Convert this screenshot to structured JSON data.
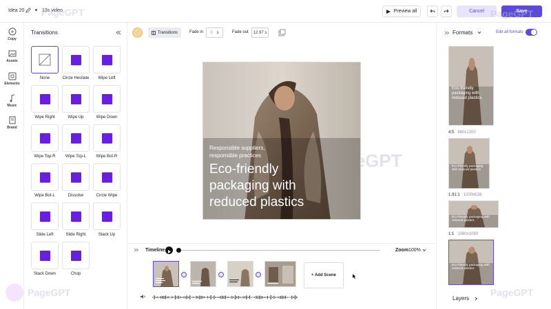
{
  "topbar": {
    "project_name": "Idea 20",
    "video_length": "13s video",
    "preview_label": "Preview all",
    "cancel_label": "Cancel",
    "save_label": "Save"
  },
  "rail": {
    "items": [
      {
        "label": "Copy",
        "icon": "copy-icon"
      },
      {
        "label": "Assets",
        "icon": "image-icon"
      },
      {
        "label": "Elements",
        "icon": "elements-icon"
      },
      {
        "label": "Music",
        "icon": "music-note-icon"
      },
      {
        "label": "Brand",
        "icon": "brand-book-icon"
      }
    ]
  },
  "transitions": {
    "title": "Transitions",
    "selected": "None",
    "items": [
      "None",
      "Circle Hesitate",
      "Wipe Left",
      "Wipe Right",
      "Wipe Up",
      "Wipe Down",
      "Wipe Top-R",
      "Wipe Top-L",
      "Wipe Bot-R",
      "Wipe Bot-L",
      "Dissolve",
      "Circle Wipe",
      "Slide Left",
      "Slide Right",
      "Stack Up",
      "Stack Down",
      "Chop"
    ]
  },
  "toolbar": {
    "swatch_color": "#f5d59a",
    "transitions_label": "Transitions",
    "fade_in_label": "Fade in",
    "fade_in_value": "0",
    "fade_in_unit": "s",
    "fade_out_label": "Fade out",
    "fade_out_value": "12.97 s"
  },
  "canvas": {
    "subtitle": "Responsible suppliers, responsible practices",
    "headline": "Eco-friendly packaging with reduced plastics"
  },
  "timeline": {
    "label": "Timeline",
    "zoom_label": "Zoom",
    "zoom_value": "100%",
    "add_scene_label": "+ Add Scene",
    "playhead_fraction": 0.0
  },
  "formats": {
    "title": "Formats",
    "edit_all_label": "Edit all formats",
    "edit_all_enabled": true,
    "items": [
      {
        "ratio": "4:5",
        "size": "960x1200"
      },
      {
        "ratio": "1.91:1",
        "size": "1200x628"
      },
      {
        "ratio": "1:1",
        "size": "1080x1080"
      },
      {
        "ratio": "",
        "size": ""
      }
    ],
    "layers_label": "Layers"
  },
  "watermark": "PageGPT",
  "colors": {
    "accent": "#5b4bd8",
    "tile_square": "#6a1fe0",
    "save_bg": "#5b4bd8",
    "cancel_bg": "#e7e4fb"
  }
}
